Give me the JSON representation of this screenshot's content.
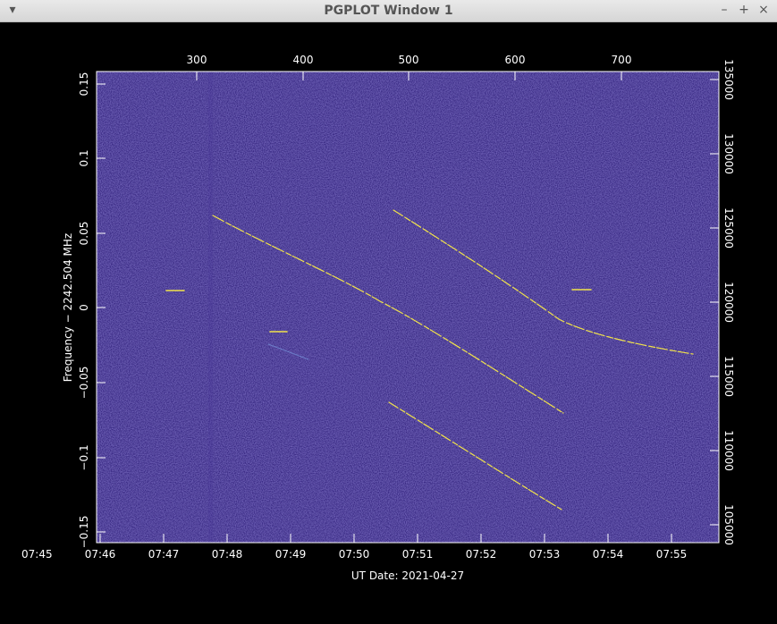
{
  "window": {
    "title": "PGPLOT Window 1",
    "menu_icon": "▾",
    "minimize_icon": "–",
    "maximize_icon": "+",
    "close_icon": "×"
  },
  "plot": {
    "xlabel": "UT Date: 2021-04-27",
    "ylabel": "Frequency − 2242.504 MHz",
    "bottom_ticks": [
      "07:45",
      "07:46",
      "07:47",
      "07:48",
      "07:49",
      "07:50",
      "07:51",
      "07:52",
      "07:53",
      "07:54",
      "07:55"
    ],
    "top_ticks": [
      "300",
      "400",
      "500",
      "600",
      "700"
    ],
    "left_ticks": [
      "0.15",
      "0.1",
      "0.05",
      "0",
      "−0.05",
      "−0.1",
      "−0.15"
    ],
    "right_ticks": [
      "135000",
      "130000",
      "125000",
      "120000",
      "115000",
      "110000",
      "105000"
    ],
    "colors": {
      "background": "#000000",
      "spectrogram": "#3a2a86",
      "trace": "#f2e34a",
      "axis": "#ffffff"
    }
  }
}
